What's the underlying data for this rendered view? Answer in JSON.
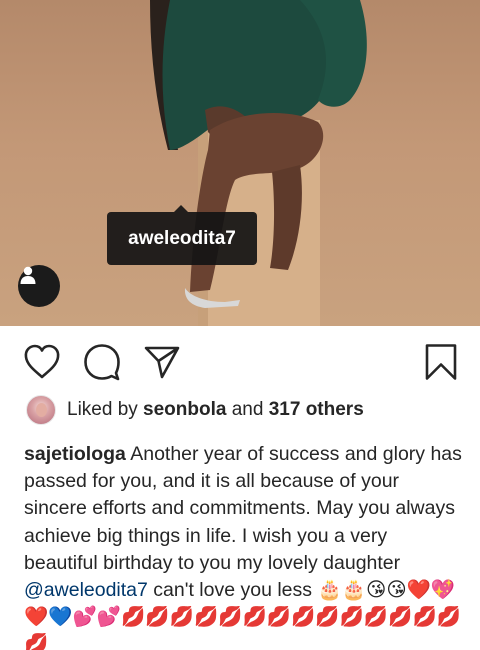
{
  "photo": {
    "tag_username": "aweleodita7"
  },
  "actions": {
    "like_icon": "heart-icon",
    "comment_icon": "comment-icon",
    "share_icon": "send-icon",
    "save_icon": "bookmark-icon"
  },
  "likes": {
    "prefix": "Liked by ",
    "first_user": "seonbola",
    "middle": " and ",
    "others": "317 others"
  },
  "caption": {
    "username": "sajetiologa",
    "text": " Another year of success and glory has passed for you, and it is all because of your sincere efforts and commitments. May you always achieve big things in life. I wish you a very beautiful birthday to you my lovely daughter ",
    "mention": "@aweleodita7",
    "text_after": " can't love you less ",
    "emojis": "🎂🎂😘😘❤️💖❤️💙💕💕💋💋💋💋💋💋💋💋💋💋💋💋💋💋💋"
  },
  "colors": {
    "mention": "#00376b",
    "dress": "#1d4a3e",
    "backdrop": "#c49c7a"
  }
}
